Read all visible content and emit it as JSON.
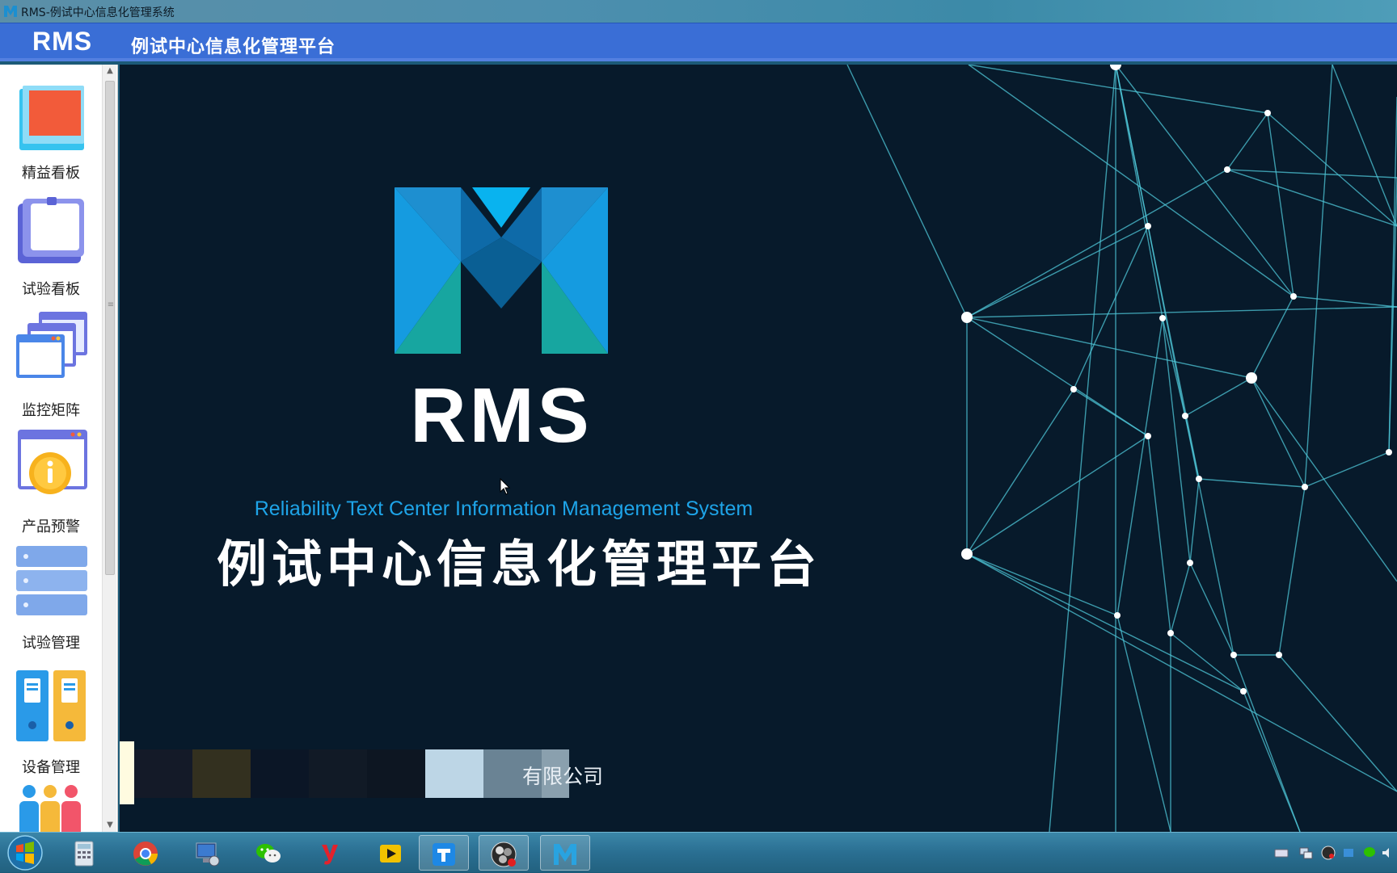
{
  "window": {
    "title": "RMS-例试中心信息化管理系统"
  },
  "header": {
    "brand": "RMS",
    "platform_name": "例试中心信息化管理平台"
  },
  "sidebar": {
    "items": [
      {
        "label": "精益看板",
        "icon": "lean-board-icon"
      },
      {
        "label": "试验看板",
        "icon": "test-board-icon"
      },
      {
        "label": "监控矩阵",
        "icon": "monitor-matrix-icon"
      },
      {
        "label": "产品预警",
        "icon": "product-warning-icon"
      },
      {
        "label": "试验管理",
        "icon": "test-management-icon"
      },
      {
        "label": "设备管理",
        "icon": "equipment-management-icon"
      },
      {
        "label": "",
        "icon": "personnel-icon"
      }
    ]
  },
  "splash": {
    "logo_text": "RMS",
    "subtitle_en": "Reliability Text Center Information Management System",
    "title_cn": "例试中心信息化管理平台",
    "company": "有限公司"
  },
  "taskbar": {
    "apps": [
      {
        "name": "start-button-icon"
      },
      {
        "name": "calculator-icon"
      },
      {
        "name": "chrome-icon"
      },
      {
        "name": "remote-desktop-icon"
      },
      {
        "name": "wechat-icon"
      },
      {
        "name": "youdao-icon"
      },
      {
        "name": "media-player-icon"
      },
      {
        "name": "app-blue-icon"
      },
      {
        "name": "obs-icon"
      },
      {
        "name": "rms-app-icon"
      }
    ],
    "tray": [
      "keyboard-icon",
      "network-icon",
      "obs-tray-icon",
      "bluetooth-icon",
      "wechat-tray-icon",
      "volume-icon"
    ]
  },
  "colors": {
    "header_bg": "#3a6ed6",
    "splash_bg": "#071a2b",
    "accent_blue": "#1ea4e8",
    "network_line": "#4fc7d8"
  }
}
